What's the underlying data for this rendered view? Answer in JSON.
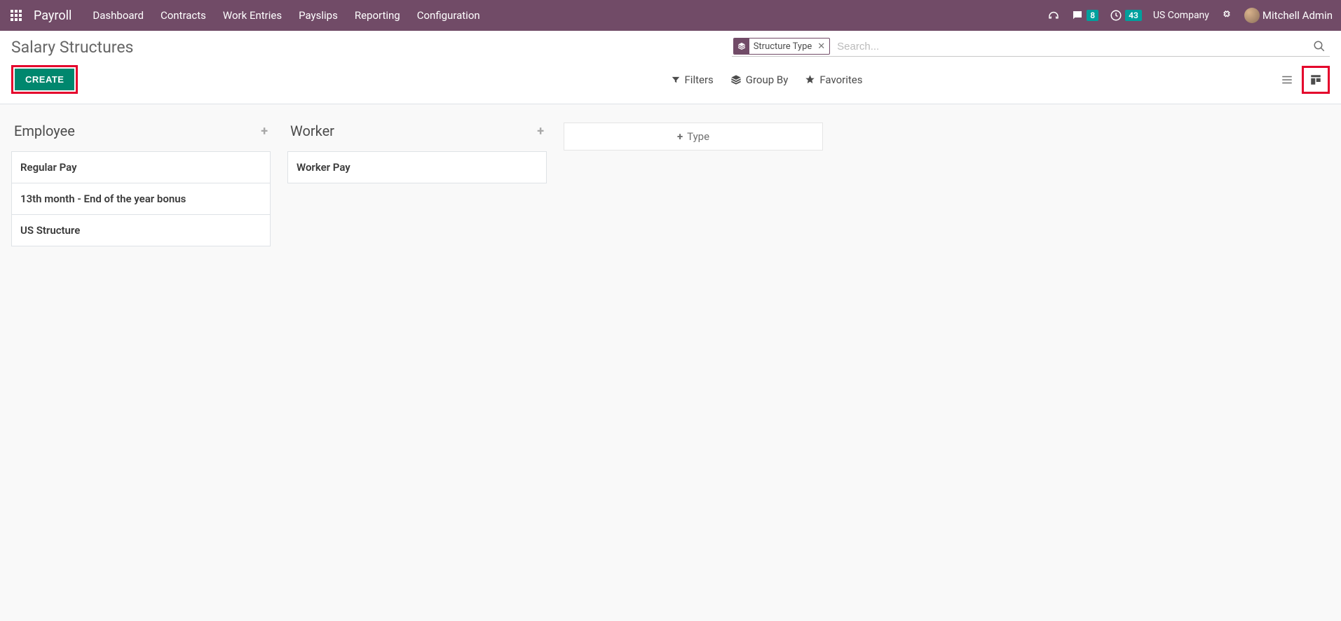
{
  "nav": {
    "brand": "Payroll",
    "items": [
      "Dashboard",
      "Contracts",
      "Work Entries",
      "Payslips",
      "Reporting",
      "Configuration"
    ]
  },
  "systray": {
    "messages_count": "8",
    "activities_count": "43",
    "company": "US Company",
    "user": "Mitchell Admin"
  },
  "page": {
    "title": "Salary Structures",
    "create_label": "CREATE"
  },
  "search": {
    "facet_label": "Structure Type",
    "placeholder": "Search...",
    "filters": "Filters",
    "groupby": "Group By",
    "favorites": "Favorites"
  },
  "board": {
    "columns": [
      {
        "title": "Employee",
        "cards": [
          "Regular Pay",
          "13th month - End of the year bonus",
          "US Structure"
        ]
      },
      {
        "title": "Worker",
        "cards": [
          "Worker Pay"
        ]
      }
    ],
    "add_column_label": "Type"
  }
}
